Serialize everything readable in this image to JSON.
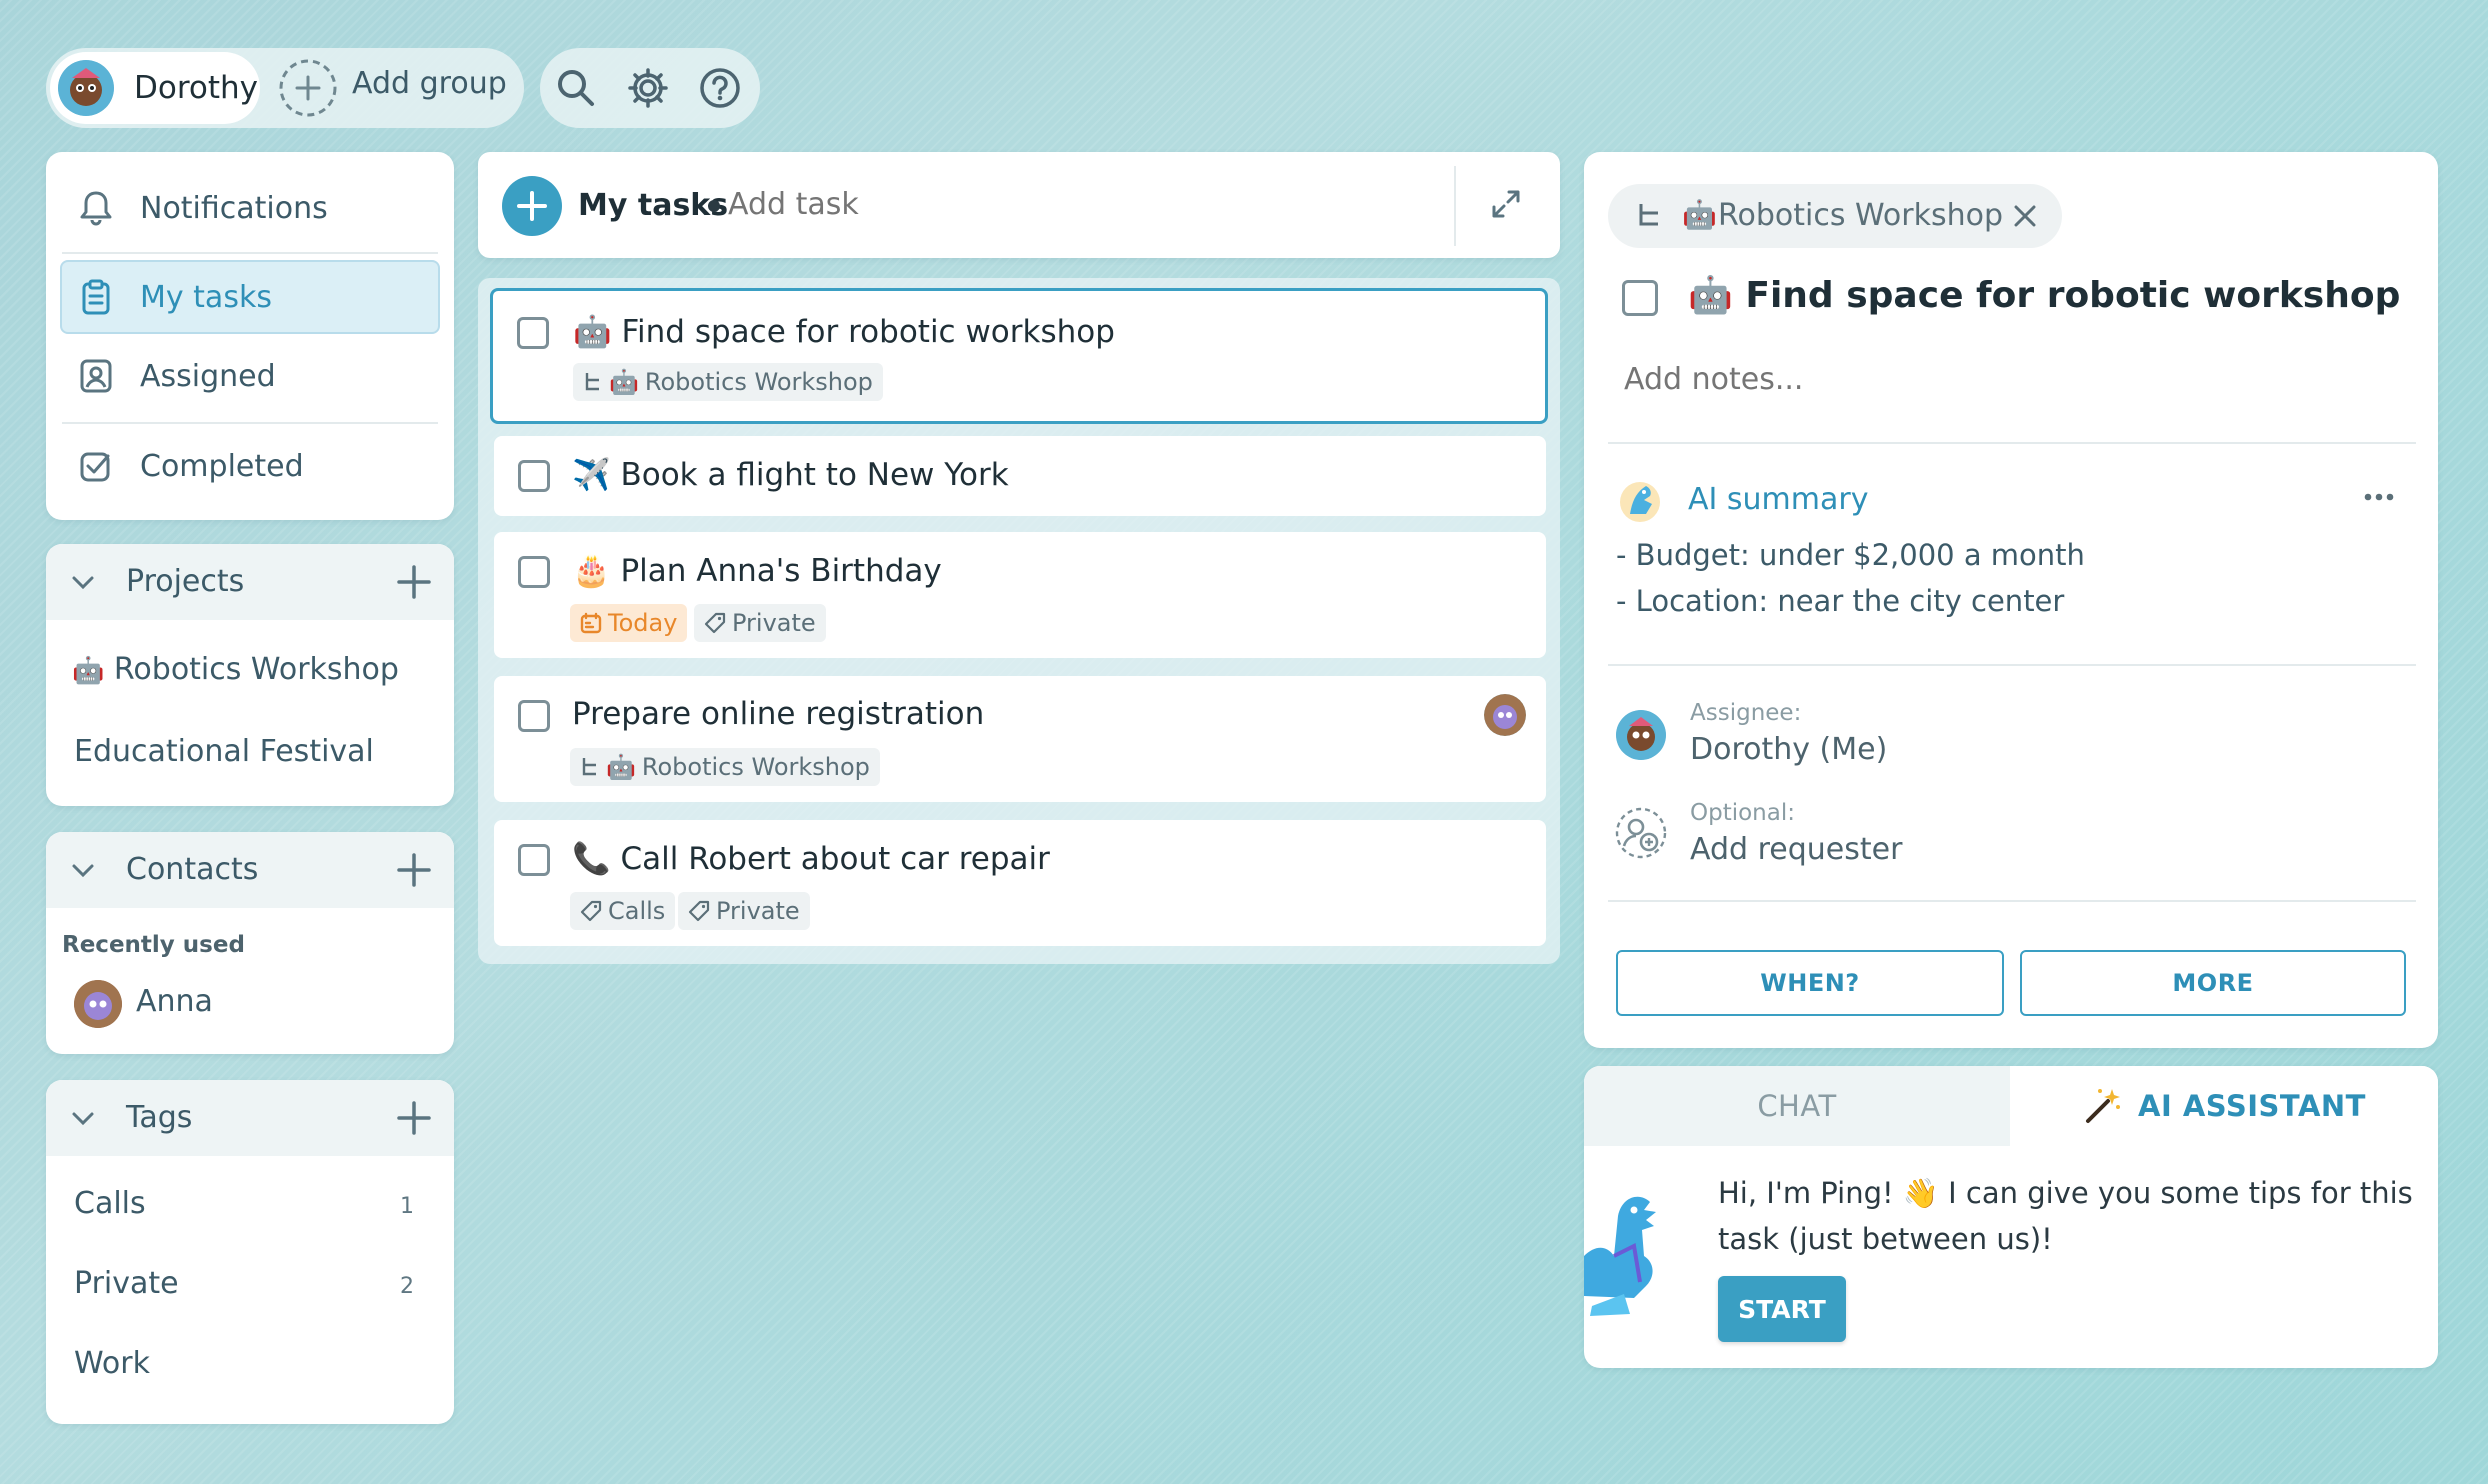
{
  "topbar": {
    "user_name": "Dorothy",
    "add_group_label": "Add group"
  },
  "sidebar": {
    "nav": [
      {
        "label": "Notifications"
      },
      {
        "label": "My tasks"
      },
      {
        "label": "Assigned"
      },
      {
        "label": "Completed"
      }
    ],
    "projects": {
      "title": "Projects",
      "items": [
        {
          "emoji": "🤖",
          "label": "Robotics Workshop"
        },
        {
          "label": "Educational Festival"
        }
      ]
    },
    "contacts": {
      "title": "Contacts",
      "recent_label": "Recently used",
      "items": [
        {
          "label": "Anna"
        }
      ]
    },
    "tags": {
      "title": "Tags",
      "items": [
        {
          "label": "Calls",
          "count": "1"
        },
        {
          "label": "Private",
          "count": "2"
        },
        {
          "label": "Work",
          "count": ""
        }
      ]
    }
  },
  "tasks_panel": {
    "title": "My tasks",
    "add_placeholder": "Add task",
    "tasks": [
      {
        "emoji": "🤖",
        "title": "Find space for robotic workshop",
        "chips": [
          {
            "emoji": "🤖",
            "label": "Robotics Workshop"
          }
        ]
      },
      {
        "emoji": "✈️",
        "title": "Book a flight to New York",
        "chips": []
      },
      {
        "emoji": "🎂",
        "title": "Plan Anna's Birthday",
        "chips": [
          {
            "label": "Today"
          },
          {
            "label": "Private"
          }
        ]
      },
      {
        "emoji": "",
        "title": "Prepare online registration",
        "chips": [
          {
            "emoji": "🤖",
            "label": "Robotics Workshop"
          }
        ]
      },
      {
        "emoji": "📞",
        "title": "Call Robert about car repair",
        "chips": [
          {
            "label": "Calls"
          },
          {
            "label": "Private"
          }
        ]
      }
    ]
  },
  "detail": {
    "project_chip": {
      "emoji": "🤖",
      "label": "Robotics Workshop"
    },
    "task_emoji": "🤖",
    "task_title": "Find space for robotic workshop",
    "notes_placeholder": "Add notes...",
    "ai_summary": {
      "title": "AI summary",
      "lines": [
        "- Budget: under $2,000 a month",
        "- Location: near the city center"
      ]
    },
    "assignee_label": "Assignee:",
    "assignee_value": "Dorothy (Me)",
    "optional_label": "Optional:",
    "requester_value": "Add requester",
    "when_button": "WHEN?",
    "more_button": "MORE"
  },
  "assistant": {
    "tabs": [
      {
        "label": "CHAT"
      },
      {
        "label": "AI ASSISTANT"
      }
    ],
    "message": "Hi, I'm Ping! 👋 I can give you some tips for this task (just between us)!",
    "start_button": "START"
  },
  "colors": {
    "accent": "#3a9fc3",
    "selected_nav_bg": "#dbeff6",
    "today_orange": "#e8872a"
  },
  "icons": [
    "search-icon",
    "gear-icon",
    "help-icon",
    "bell-icon",
    "clipboard-icon",
    "contact-icon",
    "check-square-icon",
    "chevron-down-icon",
    "plus-icon",
    "expand-icon",
    "subtask-icon",
    "close-icon",
    "tag-icon",
    "calendar-icon",
    "more-icon",
    "add-person-icon",
    "magic-wand-icon"
  ]
}
